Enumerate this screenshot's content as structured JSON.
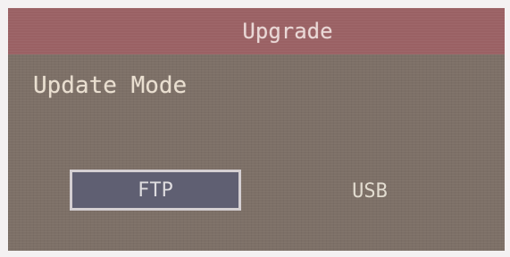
{
  "dialog": {
    "title": "Upgrade",
    "mode_label": "Update Mode"
  },
  "options": [
    {
      "label": "FTP",
      "selected": true
    },
    {
      "label": "USB",
      "selected": false
    }
  ],
  "colors": {
    "title_bar": "#9a6164",
    "panel": "#7d7067",
    "selected_option": "#5f5f72",
    "selection_border": "#d4cfd2"
  }
}
